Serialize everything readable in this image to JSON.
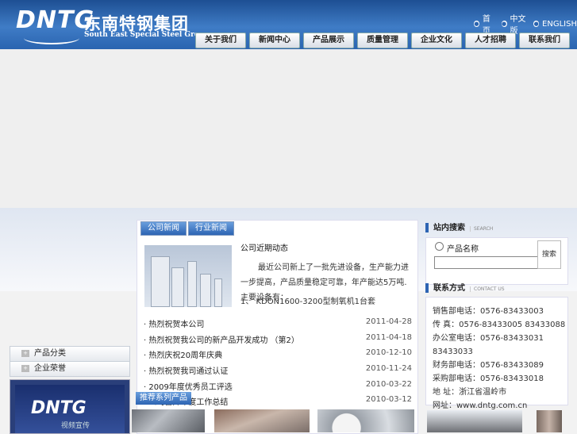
{
  "header": {
    "logo_mark": "DNTG",
    "logo_cn": "东南特钢集团",
    "logo_en": "South East Special Steel Group",
    "links": [
      "首 页",
      "中文版",
      "ENGLISH"
    ]
  },
  "nav": {
    "items": [
      "关于我们",
      "新闻中心",
      "产品展示",
      "质量管理",
      "企业文化",
      "人才招聘",
      "联系我们"
    ]
  },
  "sidebar": {
    "items": [
      "产品分类",
      "企业荣誉"
    ],
    "video_logo": "DNTG",
    "video_caption": "视频宣传"
  },
  "news": {
    "tabs": [
      "公司新闻",
      "行业新闻"
    ],
    "featured_title": "公司近期动态",
    "featured_body": "最近公司新上了一批先进设备，生产能力进一步提高，产品质量稳定可靠，年产能达5万吨.主要设备有：",
    "featured_sub": "1、    KDON1600-3200型制氧机1台套",
    "list": [
      {
        "title": "热烈祝贺本公司",
        "date": "2011-04-28"
      },
      {
        "title": "热烈祝贺我公司的新产品开发成功 （第2）",
        "date": "2011-04-18"
      },
      {
        "title": "热烈庆祝20周年庆典",
        "date": "2010-12-10"
      },
      {
        "title": "热烈祝贺我司通过认证",
        "date": "2010-11-24"
      },
      {
        "title": "2009年度优秀员工评选",
        "date": "2010-03-22"
      },
      {
        "title": "公司召开年度工作总结",
        "date": "2010-03-12"
      }
    ]
  },
  "recommended": {
    "label": "推荐系列产品"
  },
  "search": {
    "title": "站内搜索",
    "title_en": "SEARCH",
    "radio_label": "产品名称",
    "input_value": "",
    "button": "搜索"
  },
  "contact": {
    "title": "联系方式",
    "title_en": "CONTACT US",
    "lines": [
      "销售部电话：0576-83433003",
      "传 真：0576-83433005 83433088",
      "办公室电话：0576-83433031 83433033",
      "财务部电话：0576-83433089",
      "采购部电话：0576-83433018",
      "地 址：浙江省温岭市",
      "网址：www.dntg.com.cn"
    ]
  }
}
